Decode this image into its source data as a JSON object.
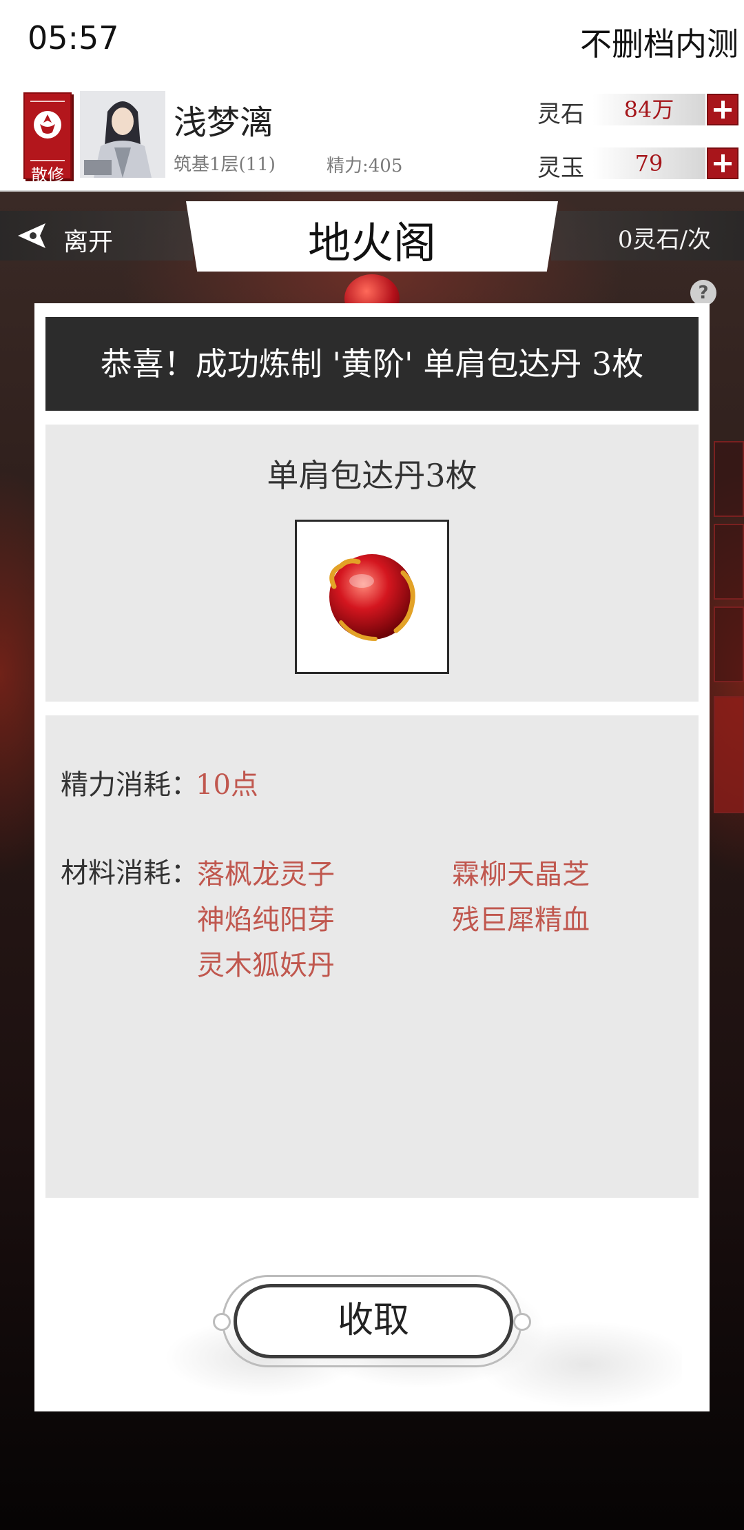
{
  "status_bar": {
    "time": "05:57",
    "right_text": "不删档内测"
  },
  "player": {
    "sect_label": "散修",
    "name": "浅梦漓",
    "realm": "筑基1层(11)",
    "energy": "精力:405",
    "currencies": [
      {
        "label": "灵石",
        "value": "84万"
      },
      {
        "label": "灵玉",
        "value": "79"
      }
    ]
  },
  "title_bar": {
    "leave_label": "离开",
    "title": "地火阁",
    "cost": "0灵石/次"
  },
  "dialog": {
    "banner": "恭喜！成功炼制 '黄阶' 单肩包达丹 3枚",
    "result_name": "单肩包达丹3枚",
    "energy_cost_label": "精力消耗：",
    "energy_cost_value": "10点",
    "materials_label": "材料消耗：",
    "materials": [
      "落枫龙灵子",
      "霖柳天晶芝",
      "神焰纯阳芽",
      "残巨犀精血",
      "灵木狐妖丹"
    ],
    "collect_label": "收取"
  },
  "colors": {
    "accent_red": "#a8151b",
    "cost_text": "#c0574e",
    "banner_bg": "#2c2c2c"
  },
  "icons": [
    "sect-emblem-icon",
    "avatar",
    "plus-icon",
    "back-arrow-icon",
    "help-icon",
    "red-pill-icon"
  ]
}
